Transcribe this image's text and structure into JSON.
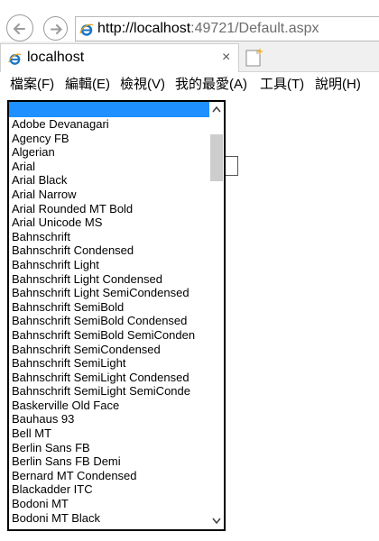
{
  "browser": {
    "url_host": "http://localhost",
    "url_rest": ":49721/Default.aspx",
    "tab_title": "localhost",
    "tab_close": "×"
  },
  "menu": {
    "items": [
      "檔案(F)",
      "編輯(E)",
      "檢視(V)",
      "我的最愛(A)",
      "工具(T)",
      "說明(H)"
    ]
  },
  "font_list": {
    "selected_value": "",
    "options": [
      "Adobe Devanagari",
      "Agency FB",
      "Algerian",
      "Arial",
      "Arial Black",
      "Arial Narrow",
      "Arial Rounded MT Bold",
      "Arial Unicode MS",
      "Bahnschrift",
      "Bahnschrift Condensed",
      "Bahnschrift Light",
      "Bahnschrift Light Condensed",
      "Bahnschrift Light SemiCondensed",
      "Bahnschrift SemiBold",
      "Bahnschrift SemiBold Condensed",
      "Bahnschrift SemiBold SemiConden",
      "Bahnschrift SemiCondensed",
      "Bahnschrift SemiLight",
      "Bahnschrift SemiLight Condensed",
      "Bahnschrift SemiLight SemiConde",
      "Baskerville Old Face",
      "Bauhaus 93",
      "Bell MT",
      "Berlin Sans FB",
      "Berlin Sans FB Demi",
      "Bernard MT Condensed",
      "Blackadder ITC",
      "Bodoni MT",
      "Bodoni MT Black"
    ]
  },
  "colors": {
    "selection": "#1e90ff",
    "ie_blue": "#1a76c9"
  }
}
